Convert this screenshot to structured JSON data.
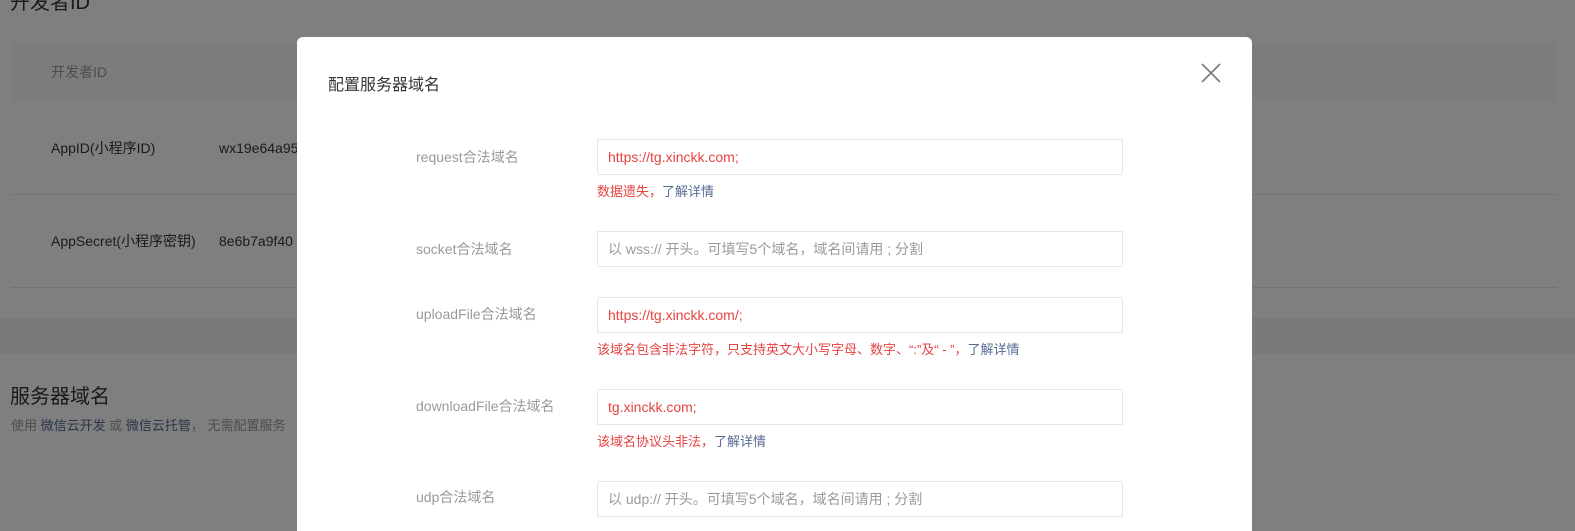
{
  "background": {
    "section_title": "开发者ID",
    "table_header": "开发者ID",
    "rows": [
      {
        "key": "AppID(小程序ID)",
        "value": "wx19e64a95"
      },
      {
        "key": "AppSecret(小程序密钥)",
        "value": "8e6b7a9f40"
      }
    ],
    "server_title": "服务器域名",
    "server_desc_prefix": "使用 ",
    "server_desc_link1": "微信云开发",
    "server_desc_mid": " 或 ",
    "server_desc_link2": "微信云托管",
    "server_desc_suffix": "， 无需配置服务"
  },
  "dialog": {
    "title": "配置服务器域名",
    "fields": [
      {
        "label": "request合法域名",
        "value": "https://tg.xinckk.com;",
        "tip": "数据遗失，",
        "tip_link": "了解详情"
      },
      {
        "label": "socket合法域名",
        "placeholder": "以 wss:// 开头。可填写5个域名，域名间请用 ; 分割"
      },
      {
        "label": "uploadFile合法域名",
        "value": "https://tg.xinckk.com/;",
        "tip": "该域名包含非法字符，只支持英文大小写字母、数字、“:”及“ - ”，",
        "tip_link": "了解详情"
      },
      {
        "label": "downloadFile合法域名",
        "value": "tg.xinckk.com;",
        "tip": "该域名协议头非法，",
        "tip_link": "了解详情"
      },
      {
        "label": "udp合法域名",
        "placeholder": "以 udp:// 开头。可填写5个域名，域名间请用 ; 分割"
      }
    ]
  },
  "colors": {
    "error": "#e64340",
    "link": "#576b95",
    "mask": "rgba(0,0,0,0.5)"
  }
}
